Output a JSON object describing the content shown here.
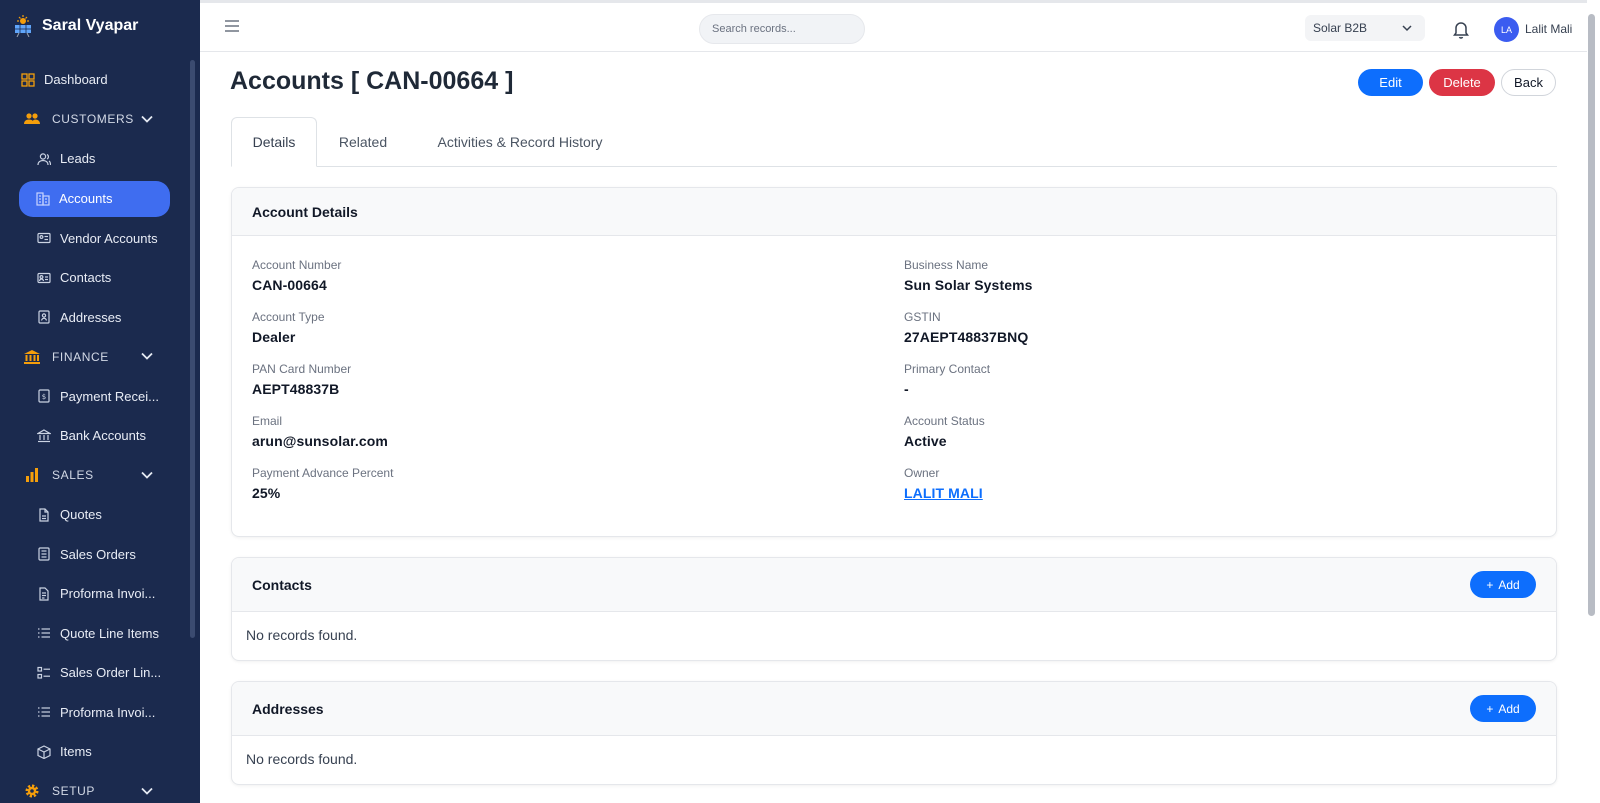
{
  "app": {
    "name": "Saral Vyapar"
  },
  "sidebar": {
    "dashboard": "Dashboard",
    "customers": {
      "label": "CUSTOMERS",
      "items": [
        "Leads",
        "Accounts",
        "Vendor Accounts",
        "Contacts",
        "Addresses"
      ]
    },
    "finance": {
      "label": "FINANCE",
      "items": [
        "Payment Recei...",
        "Bank Accounts"
      ]
    },
    "sales": {
      "label": "SALES",
      "items": [
        "Quotes",
        "Sales Orders",
        "Proforma Invoi...",
        "Quote Line Items",
        "Sales Order Lin...",
        "Proforma Invoi...",
        "Items"
      ]
    },
    "setup": {
      "label": "SETUP"
    },
    "active_item": "Accounts"
  },
  "topbar": {
    "search_placeholder": "Search records...",
    "org": "Solar B2B",
    "avatar_initials": "LA",
    "user_name": "Lalit Mali"
  },
  "page": {
    "title": "Accounts [ CAN-00664 ]",
    "buttons": {
      "edit": "Edit",
      "delete": "Delete",
      "back": "Back"
    },
    "tabs": [
      "Details",
      "Related",
      "Activities & Record History"
    ],
    "active_tab": "Details"
  },
  "account_details": {
    "heading": "Account Details",
    "left": [
      {
        "label": "Account Number",
        "value": "CAN-00664"
      },
      {
        "label": "Account Type",
        "value": "Dealer"
      },
      {
        "label": "PAN Card Number",
        "value": "AEPT48837B"
      },
      {
        "label": "Email",
        "value": "arun@sunsolar.com"
      },
      {
        "label": "Payment Advance Percent",
        "value": "25%"
      }
    ],
    "right": [
      {
        "label": "Business Name",
        "value": "Sun Solar Systems"
      },
      {
        "label": "GSTIN",
        "value": "27AEPT48837BNQ"
      },
      {
        "label": "Primary Contact",
        "value": "-"
      },
      {
        "label": "Account Status",
        "value": "Active"
      },
      {
        "label": "Owner",
        "value": "LALIT MALI"
      }
    ]
  },
  "contacts": {
    "heading": "Contacts",
    "add_label": "Add",
    "empty": "No records found."
  },
  "addresses": {
    "heading": "Addresses",
    "add_label": "Add",
    "empty": "No records found."
  },
  "colors": {
    "sidebar_bg": "#1b2a4e",
    "active_nav": "#3f6df0",
    "primary": "#0d6efd",
    "danger": "#dc3545",
    "section_icon": "#f59e0b"
  }
}
